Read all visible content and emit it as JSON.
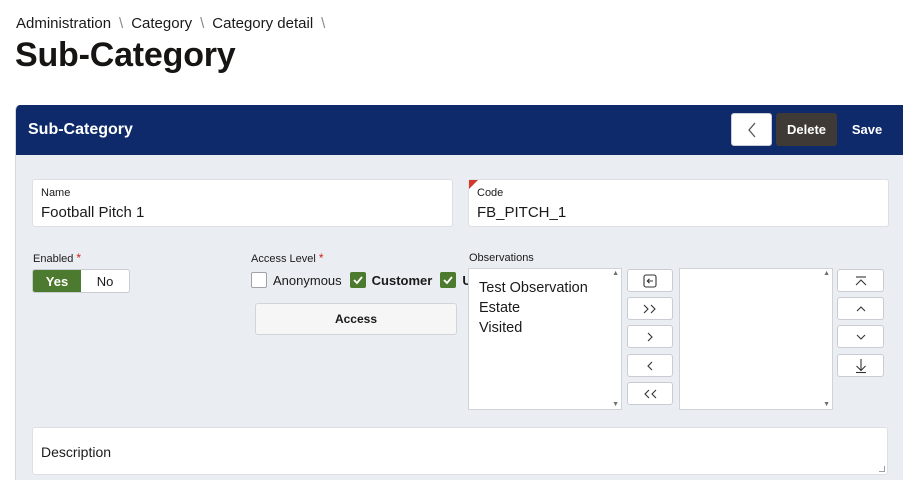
{
  "breadcrumb": {
    "items": [
      "Administration",
      "Category",
      "Category detail"
    ],
    "separator": "\\"
  },
  "page": {
    "title": "Sub-Category"
  },
  "region": {
    "title": "Sub-Category",
    "back_icon": "chevron-left-icon",
    "delete_label": "Delete",
    "save_label": "Save"
  },
  "form": {
    "name": {
      "label": "Name",
      "value": "Football Pitch 1"
    },
    "code": {
      "label": "Code",
      "value": "FB_PITCH_1"
    },
    "enabled": {
      "label": "Enabled",
      "required_mark": "*",
      "options": [
        "Yes",
        "No"
      ],
      "selected": "Yes"
    },
    "access_level": {
      "label": "Access Level",
      "required_mark": "*",
      "options": [
        {
          "label": "Anonymous",
          "checked": false
        },
        {
          "label": "Customer",
          "checked": true
        },
        {
          "label": "Us",
          "checked": true
        }
      ],
      "button_label": "Access"
    },
    "observations": {
      "label": "Observations",
      "available": [
        "Test Observation",
        "Estate",
        "Visited"
      ],
      "selected": [],
      "shuttle_icons": [
        "reset-icon",
        "move-all-right-icon",
        "move-right-icon",
        "move-left-icon",
        "move-all-left-icon"
      ],
      "order_icons": [
        "move-top-icon",
        "move-up-icon",
        "move-down-icon",
        "move-bottom-icon"
      ]
    },
    "description": {
      "placeholder": "Description"
    }
  },
  "colors": {
    "header_bg": "#0f2a6b",
    "accent_green": "#4c7a2e",
    "delete_bg": "#3f3a35",
    "required": "#c8231b",
    "region_bg": "#eaeef2"
  }
}
